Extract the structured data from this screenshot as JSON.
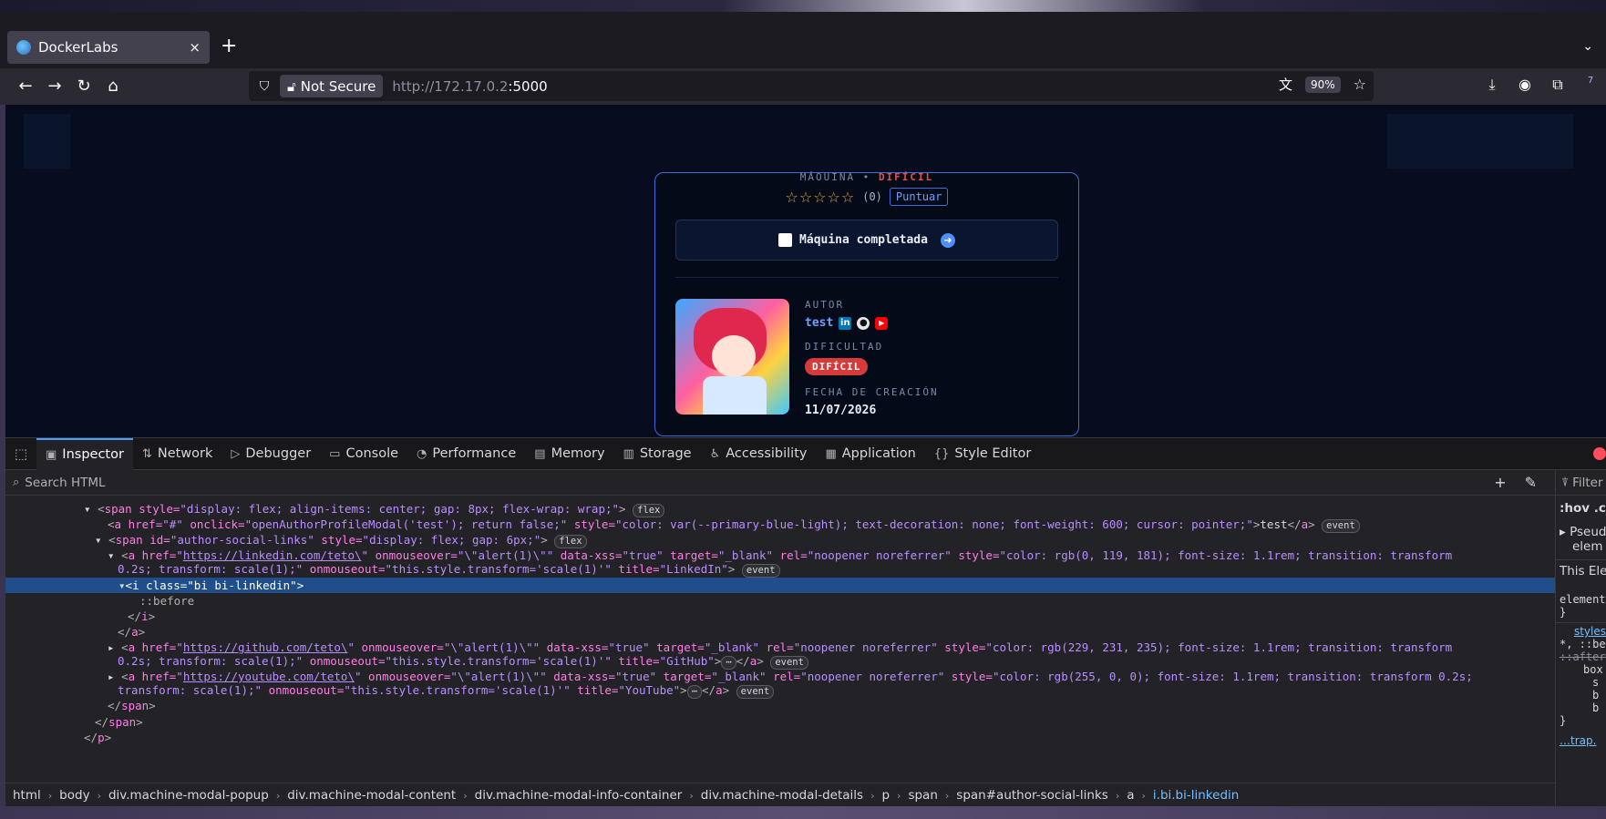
{
  "browser": {
    "tab_title": "DockerLabs",
    "tab_close": "×",
    "new_tab": "+",
    "tabs_menu": "⌄",
    "security_label": "Not Secure",
    "url_host": "http://172.17.0.2",
    "url_port": ":5000",
    "zoom": "90%",
    "extension_badge": "7"
  },
  "modal": {
    "kicker_text": "MÁQUINA • ",
    "kicker_difficulty": "DIFÍCIL",
    "stars": "☆☆☆☆☆",
    "rating_count": "(0)",
    "rate_button": "Puntuar",
    "completed_label": "Máquina completada",
    "author_label": "AUTOR",
    "author_name": "test",
    "difficulty_label": "DIFICULTAD",
    "difficulty_badge": "DIFÍCIL",
    "creation_label": "FECHA DE CREACIÓN",
    "creation_date": "11/07/2026"
  },
  "devtools": {
    "tabs": [
      {
        "label": "Inspector"
      },
      {
        "label": "Network"
      },
      {
        "label": "Debugger"
      },
      {
        "label": "Console"
      },
      {
        "label": "Performance"
      },
      {
        "label": "Memory"
      },
      {
        "label": "Storage"
      },
      {
        "label": "Accessibility"
      },
      {
        "label": "Application"
      },
      {
        "label": "Style Editor"
      }
    ],
    "search_placeholder": "Search HTML",
    "pills": {
      "flex": "flex",
      "event": "event",
      "ellipsis": "⋯"
    },
    "lines": {
      "l1_attrs": "style=",
      "l1_val": "\"display: flex; align-items: center; gap: 8px; flex-wrap: wrap;\"",
      "l2_href": "\"#\"",
      "l2_onclick": "\"openAuthorProfileModal('test'); return false;\"",
      "l2_style": "\"color: var(--primary-blue-light); text-decoration: none; font-weight: 600; cursor: pointer;\"",
      "l2_text": "test",
      "l3_id": "\"author-social-links\"",
      "l3_style": "\"display: flex; gap: 6px;\"",
      "l4_href": "https://linkedin.com/teto\\",
      "l4_rest1": "\"\\\"alert(1)\\\"\"",
      "l4_style": "\"color: rgb(0, 119, 181); font-size: 1.1rem; transition: transform",
      "l4b": "0.2s; transform: scale(1);\"",
      "l4b_onout": "\"this.style.transform='scale(1)'\"",
      "l4b_title": "\"LinkedIn\"",
      "l5_class": "\"bi bi-linkedin\"",
      "l6_pseudo": "::before",
      "l9_href": "https://github.com/teto\\",
      "l9_style": "\"color: rgb(229, 231, 235); font-size: 1.1rem; transition: transform",
      "l9b_title": "\"GitHub\"",
      "l10_href": "https://youtube.com/teto\\",
      "l10_style": "\"color: rgb(255, 0, 0); font-size: 1.1rem; transition: transform 0.2s;",
      "l10b": "transform: scale(1);\"",
      "l10b_title": "\"YouTube\""
    },
    "breadcrumbs": [
      "html",
      "body",
      "div.machine-modal-popup",
      "div.machine-modal-content",
      "div.machine-modal-info-container",
      "div.machine-modal-details",
      "p",
      "span",
      "span#author-social-links",
      "a",
      "i.bi.bi-linkedin"
    ],
    "side": {
      "filter": "Filter",
      "hov": ":hov .cl",
      "pseudo": "Pseud",
      "elem": "elem",
      "this_el": "This Ele",
      "element": "element",
      "brace": "}",
      "styles": "styles",
      "rule1": "*, ::be",
      "rule2": "::after",
      "p1": "box",
      "p2": "s",
      "p3": "b",
      "p4": "b",
      "trap": "…trap."
    }
  },
  "colors": {
    "accent": "#4a9eff",
    "modal_border": "#3b6fd8",
    "hard": "#d63a3a",
    "linkedin": "#0077b5",
    "youtube": "#ff0000"
  }
}
